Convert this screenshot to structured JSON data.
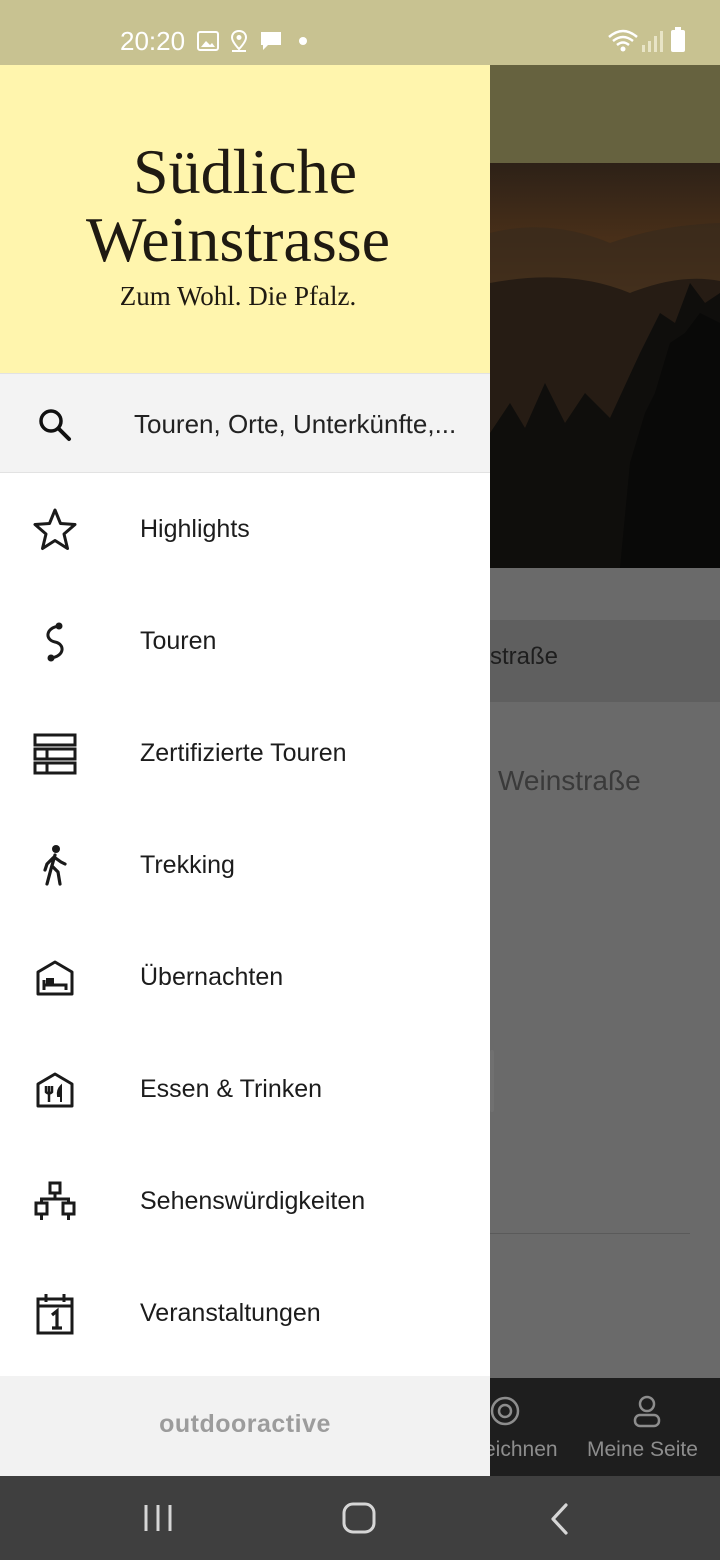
{
  "status_bar": {
    "time": "20:20",
    "left_icons": [
      "image-icon",
      "location-icon",
      "message-icon",
      "dot-icon"
    ],
    "right_icons": [
      "wifi-icon",
      "signal-icon",
      "battery-icon"
    ],
    "background_color": "#c8c291"
  },
  "drawer": {
    "logo": {
      "line1": "Südliche",
      "line2": "Weinstrasse",
      "tagline": "Zum Wohl. Die Pfalz."
    },
    "search": {
      "placeholder": "Touren, Orte, Unterkünfte,..."
    },
    "menu_items": [
      {
        "label": "Highlights",
        "icon": "star-icon"
      },
      {
        "label": "Touren",
        "icon": "route-icon"
      },
      {
        "label": "Zertifizierte Touren",
        "icon": "certified-tours-icon"
      },
      {
        "label": "Trekking",
        "icon": "hiker-icon"
      },
      {
        "label": "Übernachten",
        "icon": "bed-icon"
      },
      {
        "label": "Essen & Trinken",
        "icon": "restaurant-icon"
      },
      {
        "label": "Sehenswürdigkeiten",
        "icon": "sights-icon"
      },
      {
        "label": "Veranstaltungen",
        "icon": "calendar-icon"
      }
    ],
    "footer": {
      "brand": "outdooractive"
    },
    "header_color": "#fff5ad"
  },
  "background_app": {
    "section_title_fragment": "straße",
    "subtitle_fragment": "Weinstraße",
    "bottom_nav": [
      {
        "label": "eichnen",
        "icon": "record-icon"
      },
      {
        "label": "Meine Seite",
        "icon": "user-icon"
      }
    ]
  },
  "system_nav": {
    "buttons": [
      "recents-button",
      "home-button",
      "back-button"
    ]
  }
}
